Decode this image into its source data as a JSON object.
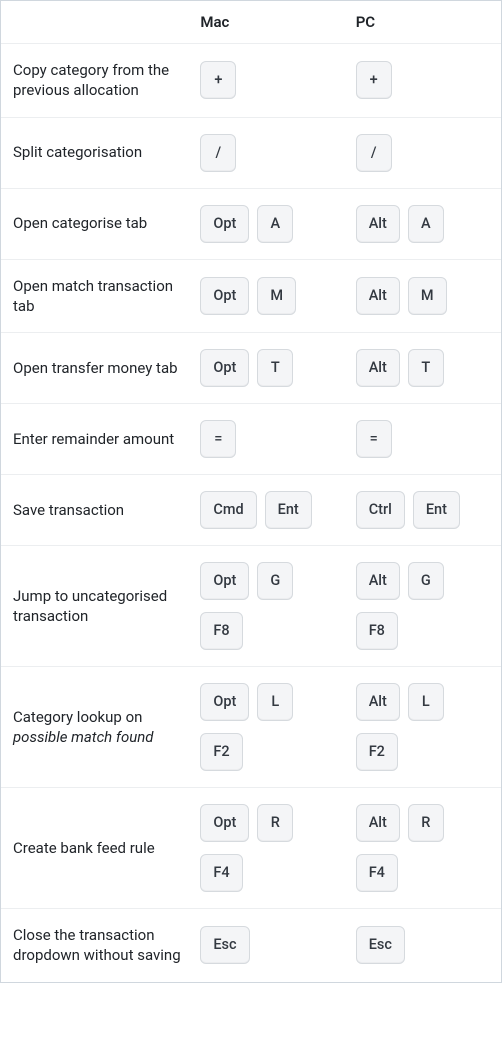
{
  "headers": {
    "blank": "",
    "mac": "Mac",
    "pc": "PC"
  },
  "rows": [
    {
      "desc": "Copy category from the previous allocation",
      "mac": [
        [
          "+"
        ]
      ],
      "pc": [
        [
          "+"
        ]
      ]
    },
    {
      "desc": "Split categorisation",
      "mac": [
        [
          "/"
        ]
      ],
      "pc": [
        [
          "/"
        ]
      ]
    },
    {
      "desc": "Open categorise tab",
      "mac": [
        [
          "Opt",
          "A"
        ]
      ],
      "pc": [
        [
          "Alt",
          "A"
        ]
      ]
    },
    {
      "desc": "Open match transaction tab",
      "mac": [
        [
          "Opt",
          "M"
        ]
      ],
      "pc": [
        [
          "Alt",
          "M"
        ]
      ]
    },
    {
      "desc": "Open transfer money tab",
      "mac": [
        [
          "Opt",
          "T"
        ]
      ],
      "pc": [
        [
          "Alt",
          "T"
        ]
      ]
    },
    {
      "desc": "Enter remainder amount",
      "mac": [
        [
          "="
        ]
      ],
      "pc": [
        [
          "="
        ]
      ]
    },
    {
      "desc": "Save transaction",
      "mac": [
        [
          "Cmd",
          "Ent"
        ]
      ],
      "pc": [
        [
          "Ctrl",
          "Ent"
        ]
      ]
    },
    {
      "desc": "Jump to uncategorised transaction",
      "mac": [
        [
          "Opt",
          "G"
        ],
        [
          "F8"
        ]
      ],
      "pc": [
        [
          "Alt",
          "G"
        ],
        [
          "F8"
        ]
      ]
    },
    {
      "desc_html": "Category lookup on <em>possible match found</em>",
      "desc": "Category lookup on possible match found",
      "mac": [
        [
          "Opt",
          "L"
        ],
        [
          "F2"
        ]
      ],
      "pc": [
        [
          "Alt",
          "L"
        ],
        [
          "F2"
        ]
      ]
    },
    {
      "desc": "Create bank feed rule",
      "mac": [
        [
          "Opt",
          "R"
        ],
        [
          "F4"
        ]
      ],
      "pc": [
        [
          "Alt",
          "R"
        ],
        [
          "F4"
        ]
      ]
    },
    {
      "desc": "Close the transaction dropdown without saving",
      "mac": [
        [
          "Esc"
        ]
      ],
      "pc": [
        [
          "Esc"
        ]
      ]
    }
  ]
}
